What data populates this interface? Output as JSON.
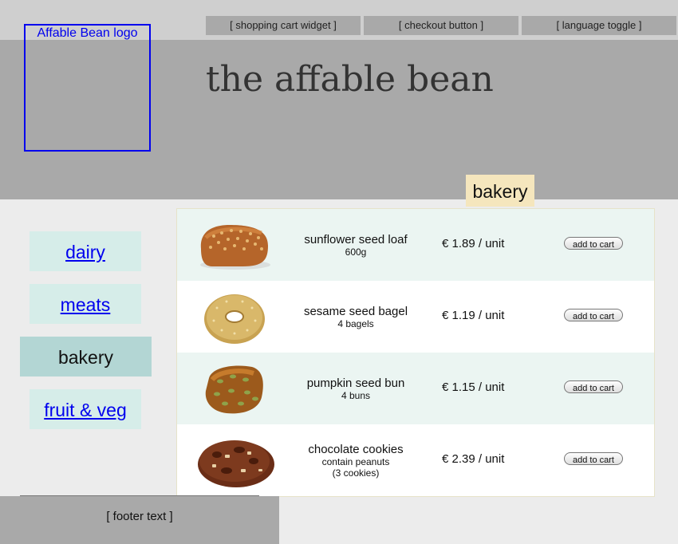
{
  "header": {
    "logo_text": "Affable Bean logo",
    "site_title": "the affable bean",
    "widgets": [
      "[ shopping cart widget ]",
      "[ checkout button ]",
      "[ language toggle ]"
    ]
  },
  "category_title": "bakery",
  "sidebar": {
    "items": [
      {
        "label": "dairy",
        "current": false
      },
      {
        "label": "meats",
        "current": false
      },
      {
        "label": "bakery",
        "current": true
      },
      {
        "label": "fruit & veg",
        "current": false
      }
    ]
  },
  "products": [
    {
      "name": "sunflower seed loaf",
      "desc": "600g",
      "desc2": "",
      "price": "€ 1.89 / unit",
      "button": "add to cart",
      "icon": "bread-loaf-icon"
    },
    {
      "name": "sesame seed bagel",
      "desc": "4 bagels",
      "desc2": "",
      "price": "€ 1.19 / unit",
      "button": "add to cart",
      "icon": "bagel-icon"
    },
    {
      "name": "pumpkin seed bun",
      "desc": "4 buns",
      "desc2": "",
      "price": "€ 1.15 / unit",
      "button": "add to cart",
      "icon": "bun-icon"
    },
    {
      "name": "chocolate cookies",
      "desc": "contain peanuts",
      "desc2": "(3 cookies)",
      "price": "€ 2.39 / unit",
      "button": "add to cart",
      "icon": "cookie-icon"
    }
  ],
  "footer": {
    "text": "[ footer text ]"
  },
  "colors": {
    "header": "#a9a9a9",
    "topbar": "#cfcfcf",
    "category_tab": "#f5e6bd",
    "sidebar_link": "#d6ede9",
    "sidebar_current": "#b3d6d4",
    "row_alt": "#ebf5f2",
    "link": "#0000ee"
  }
}
